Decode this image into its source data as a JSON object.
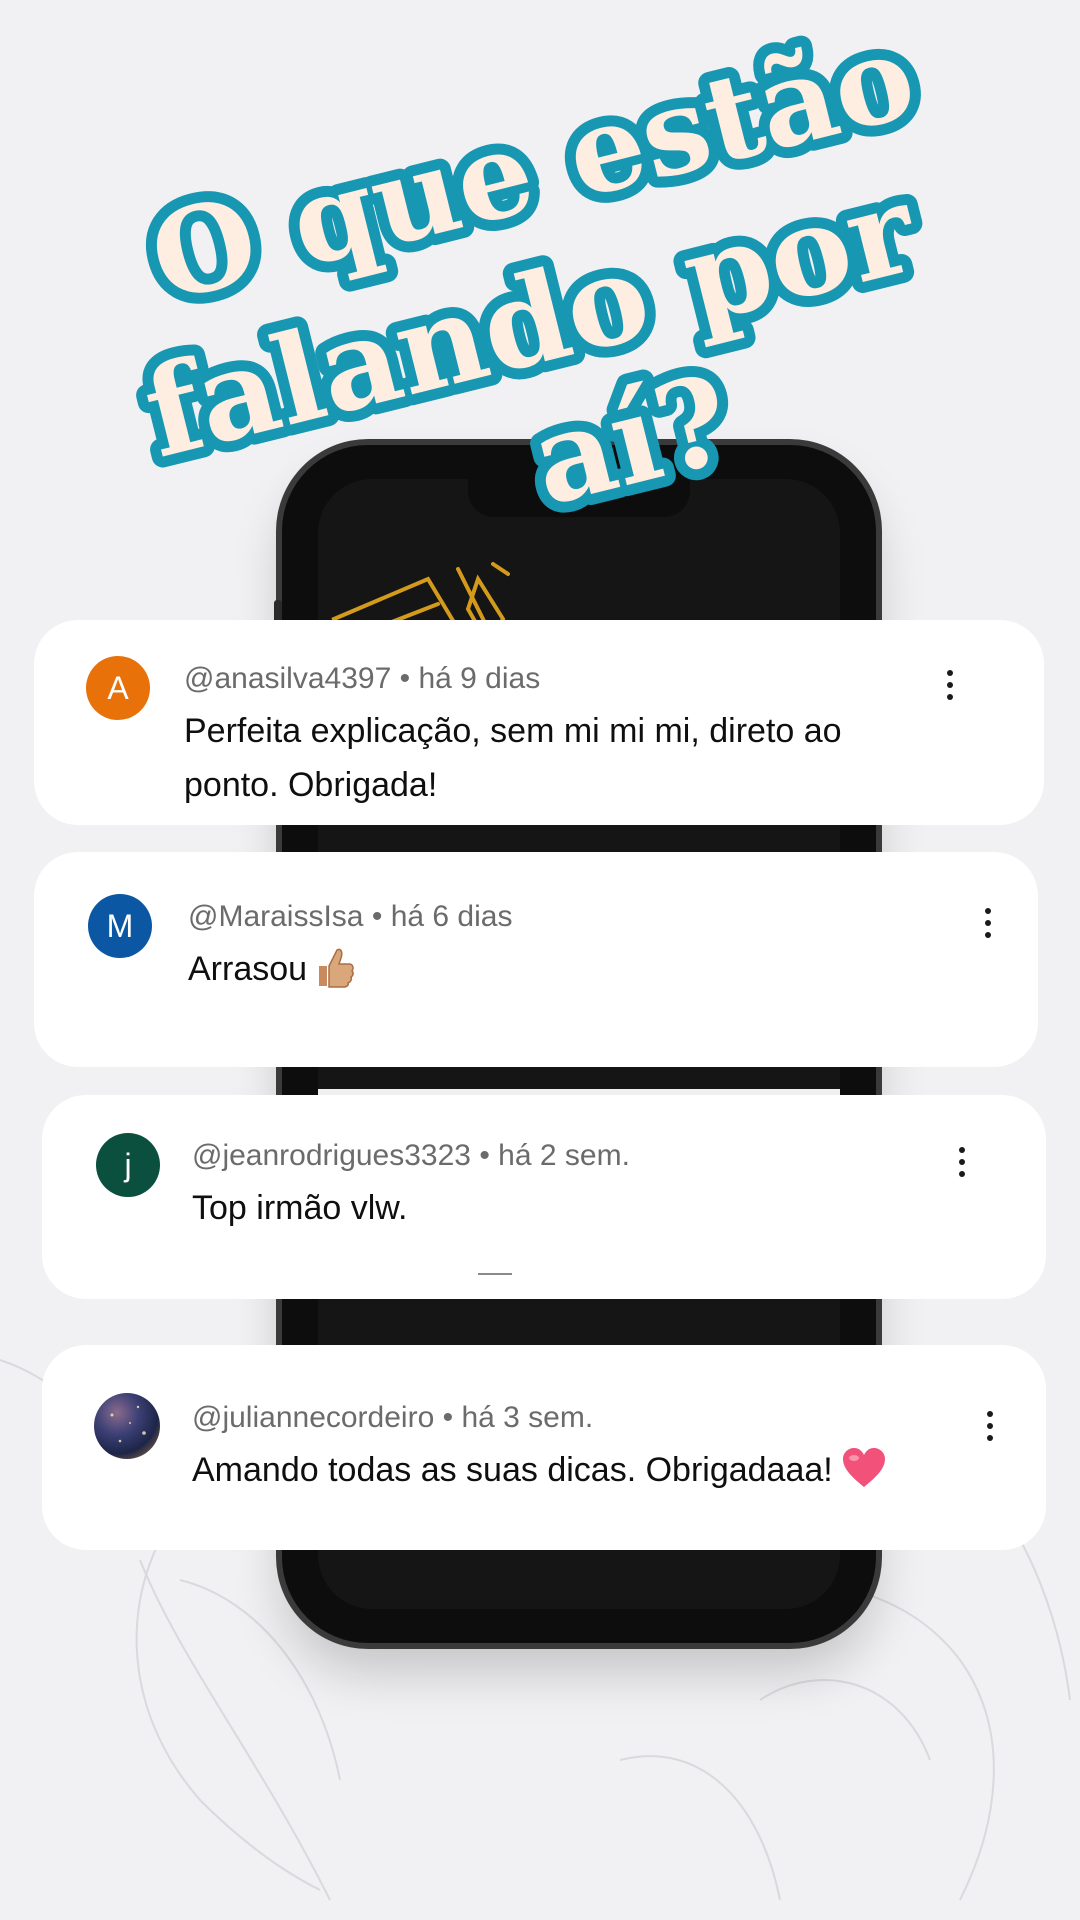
{
  "title": {
    "line1": "O que estão",
    "line2": "falando por",
    "line3": "aí?"
  },
  "colors": {
    "title_fill": "#fdeee1",
    "title_outline": "#1897b2",
    "background": "#f1f1f3"
  },
  "comments": [
    {
      "avatar_letter": "A",
      "avatar_color": "#e8710a",
      "username": "@anasilva4397",
      "time": "há 9 dias",
      "text_line1": "Perfeita explicação, sem mi mi mi, direto ao",
      "text_line2": "ponto. Obrigada!"
    },
    {
      "avatar_letter": "M",
      "avatar_color": "#0b57a4",
      "username": "@MaraissIsa",
      "time": "há 6 dias",
      "text": "Arrasou",
      "emoji": "thumbs-up-icon"
    },
    {
      "avatar_letter": "j",
      "avatar_color": "#0b4f3e",
      "username": "@jeanrodrigues3323",
      "time": "há 2 sem.",
      "text": "Top irmão vlw."
    },
    {
      "avatar_image": "photo-avatar",
      "username": "@juliannecordeiro",
      "time": "há 3 sem.",
      "text": "Amando todas as suas dicas. Obrigadaaa!",
      "emoji": "heart-icon"
    }
  ],
  "meta_separator": " • "
}
